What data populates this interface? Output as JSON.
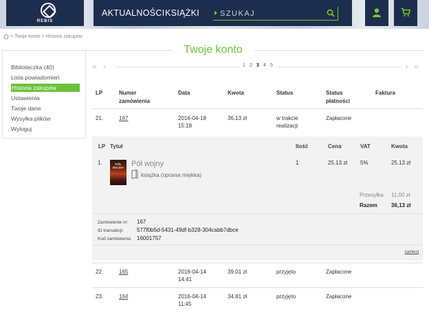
{
  "header": {
    "logo_text": "REBIS",
    "nav": [
      "AKTUALNOŚCI",
      "KSIĄŻKI"
    ],
    "search_placeholder": "SZUKAJ",
    "icons": [
      "user-icon",
      "cart-icon"
    ],
    "colors": {
      "nav_bg": "#1d2d4d",
      "accent": "#6cc23a"
    }
  },
  "breadcrumb": [
    "Twoje konto",
    "Historia zakupów"
  ],
  "page_title": "Twoje konto",
  "sidebar": {
    "items": [
      {
        "label": "Biblioteczka (40)",
        "active": false
      },
      {
        "label": "Lista powiadomień",
        "active": false
      },
      {
        "label": "Historia zakupów",
        "active": true
      },
      {
        "label": "Ustawienia",
        "active": false
      },
      {
        "label": "Twoje dane",
        "active": false
      },
      {
        "label": "Wysyłka plików",
        "active": false
      },
      {
        "label": "Wyloguj",
        "active": false
      }
    ]
  },
  "pagination": {
    "pages": [
      "1",
      "2",
      "3",
      "4",
      "5"
    ],
    "current": "3"
  },
  "orders_table": {
    "headers": {
      "lp": "LP",
      "number_1": "Numer",
      "number_2": "zamówienia",
      "date": "Data",
      "amount": "Kwota",
      "status": "Status",
      "payment_1": "Status",
      "payment_2": "płatności",
      "invoice": "Faktura"
    },
    "rows": [
      {
        "lp": "21.",
        "number": "167",
        "date": "2016-04-18",
        "time": "15:18",
        "amount": "36.13 zł",
        "status_1": "w trakcie",
        "status_2": "realizacji",
        "payment": "Zapłacone"
      },
      {
        "lp": "22.",
        "number": "165",
        "date": "2016-04-14",
        "time": "14:41",
        "amount": "39.01 zł",
        "status_1": "przyjęto",
        "status_2": "",
        "payment": "Zapłacone"
      },
      {
        "lp": "23.",
        "number": "164",
        "date": "2016-04-14",
        "time": "11:45",
        "amount": "34.81 zł",
        "status_1": "przyjęto",
        "status_2": "",
        "payment": "Zapłacone"
      }
    ]
  },
  "order_detail": {
    "headers": {
      "lp": "LP",
      "title": "Tytuł",
      "qty": "Ilość",
      "price": "Cena",
      "vat": "VAT",
      "amount": "Kwota"
    },
    "item": {
      "lp": "1.",
      "title": "Pół wojny",
      "format": "książka (oprawa miękka)",
      "qty": "1",
      "price": "25.13 zł",
      "vat": "5%",
      "amount": "25.13 zł",
      "cover_text": "PÓŁ WOJNY"
    },
    "shipping_label": "Przesyłka",
    "shipping_value": "11,00 zł",
    "total_label": "Razem",
    "total_value": "36,13 zł",
    "meta": {
      "order_no_label": "Zamówienie nr:",
      "order_no": "167",
      "transaction_label": "ID transakcji:",
      "transaction_id": "577f0b5d-5431-49df-b328-304cabb7dbce",
      "order_code_label": "Kod zamówienia:",
      "order_code": "16001757"
    },
    "close_label": "zamknij"
  }
}
